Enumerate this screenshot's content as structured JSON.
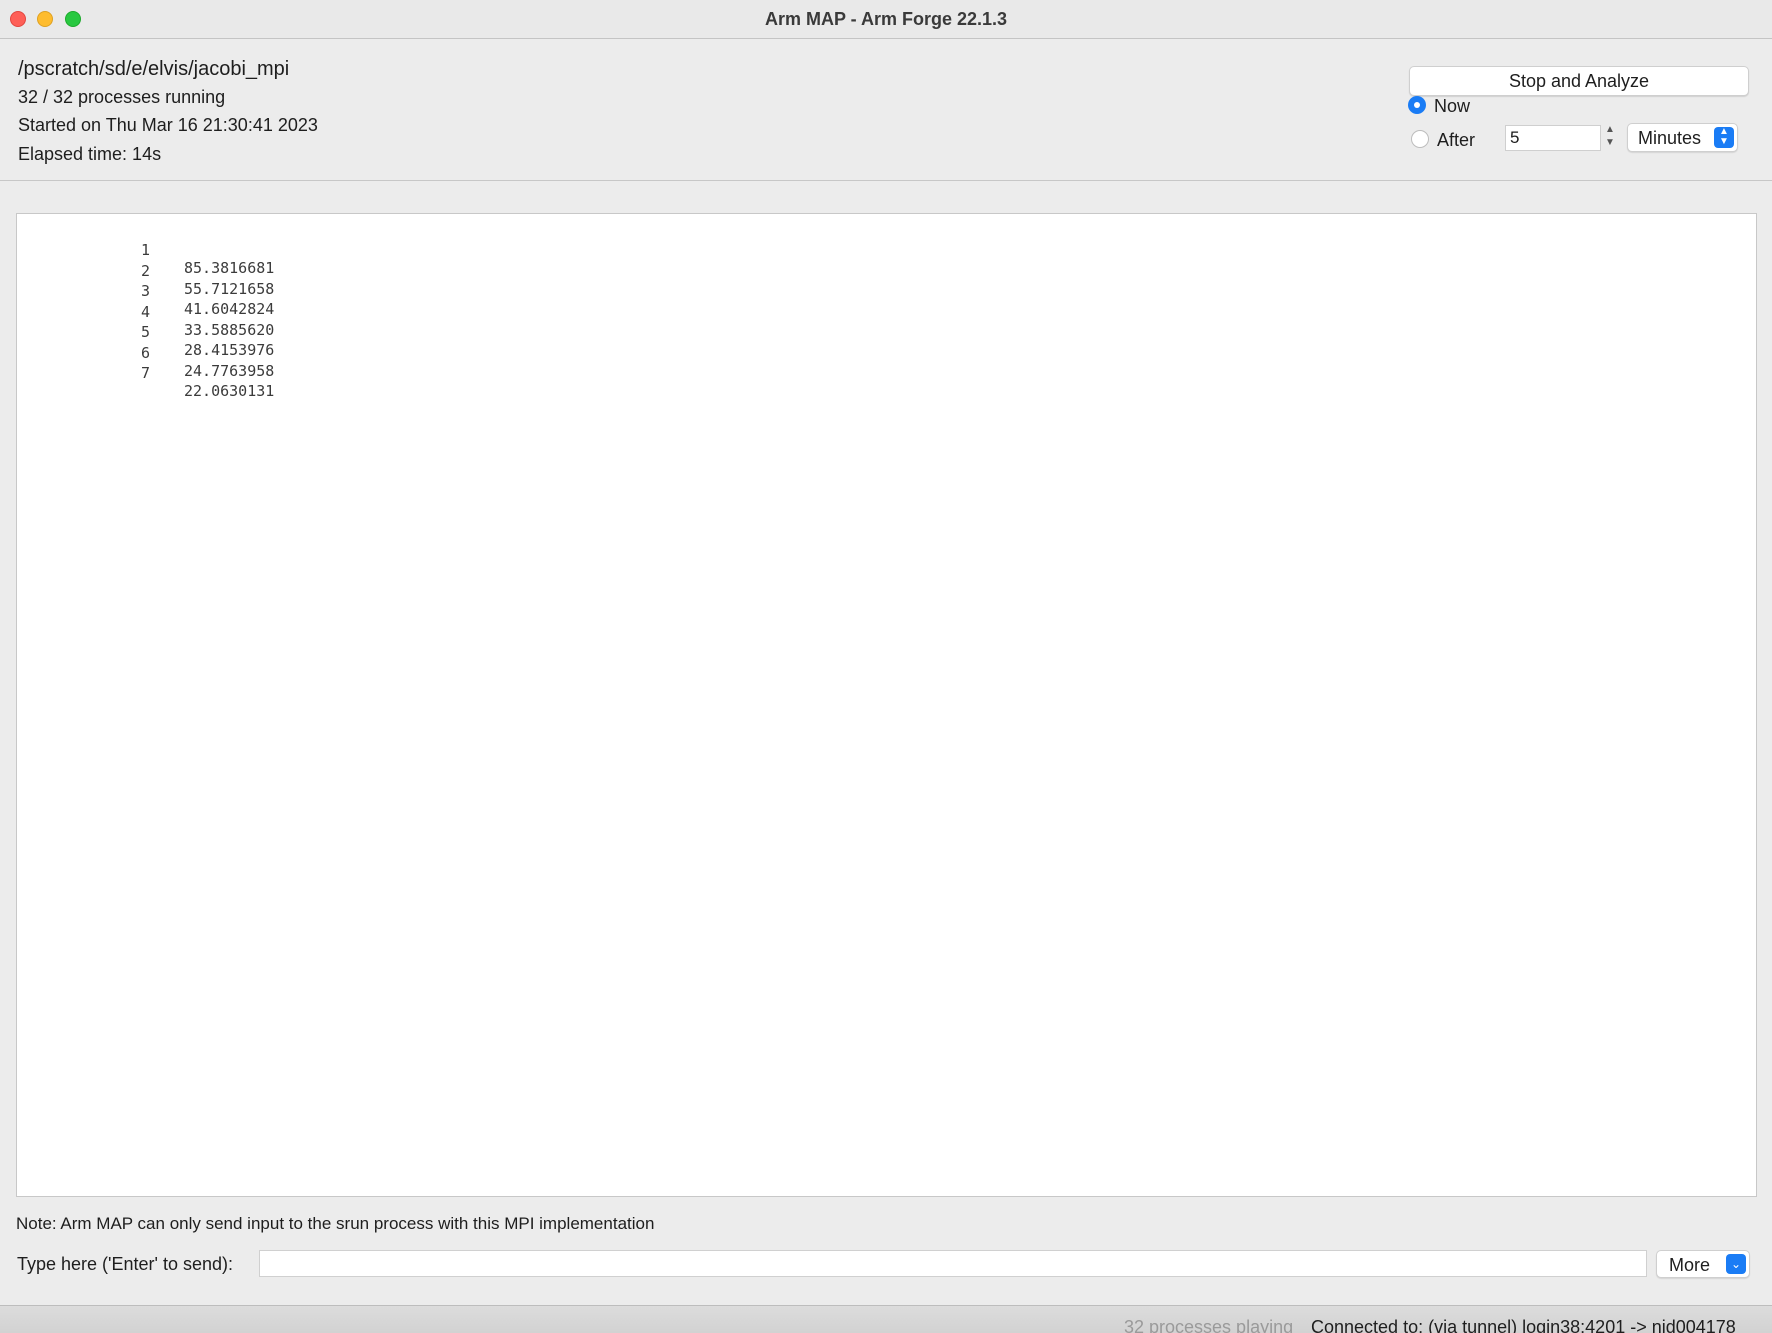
{
  "window": {
    "title": "Arm MAP - Arm Forge 22.1.3"
  },
  "info": {
    "path": "/pscratch/sd/e/elvis/jacobi_mpi",
    "processes": "32 / 32 processes running",
    "started": "Started on Thu Mar 16 21:30:41 2023",
    "elapsed": "Elapsed time: 14s"
  },
  "controls": {
    "stop_button": "Stop and Analyze",
    "now_label": "Now",
    "after_label": "After",
    "selected_option": "Now",
    "after_value": "5",
    "unit_selected": "Minutes"
  },
  "output": {
    "lines": [
      {
        "index": "1",
        "value": "85.3816681"
      },
      {
        "index": "2",
        "value": "55.7121658"
      },
      {
        "index": "3",
        "value": "41.6042824"
      },
      {
        "index": "4",
        "value": "33.5885620"
      },
      {
        "index": "5",
        "value": "28.4153976"
      },
      {
        "index": "6",
        "value": "24.7763958"
      },
      {
        "index": "7",
        "value": "22.0630131"
      }
    ]
  },
  "input": {
    "note": "Note: Arm MAP can only send input to the srun process with this MPI implementation",
    "label": "Type here ('Enter' to send):",
    "value": "",
    "more_button": "More"
  },
  "status": {
    "playing": "32 processes playing",
    "connection": "Connected to: (via tunnel) login38:4201 -> nid004178"
  },
  "colors": {
    "accent": "#1a7cf5",
    "close": "#fe5f57",
    "minimize": "#febc2e",
    "maximize": "#28c840"
  }
}
